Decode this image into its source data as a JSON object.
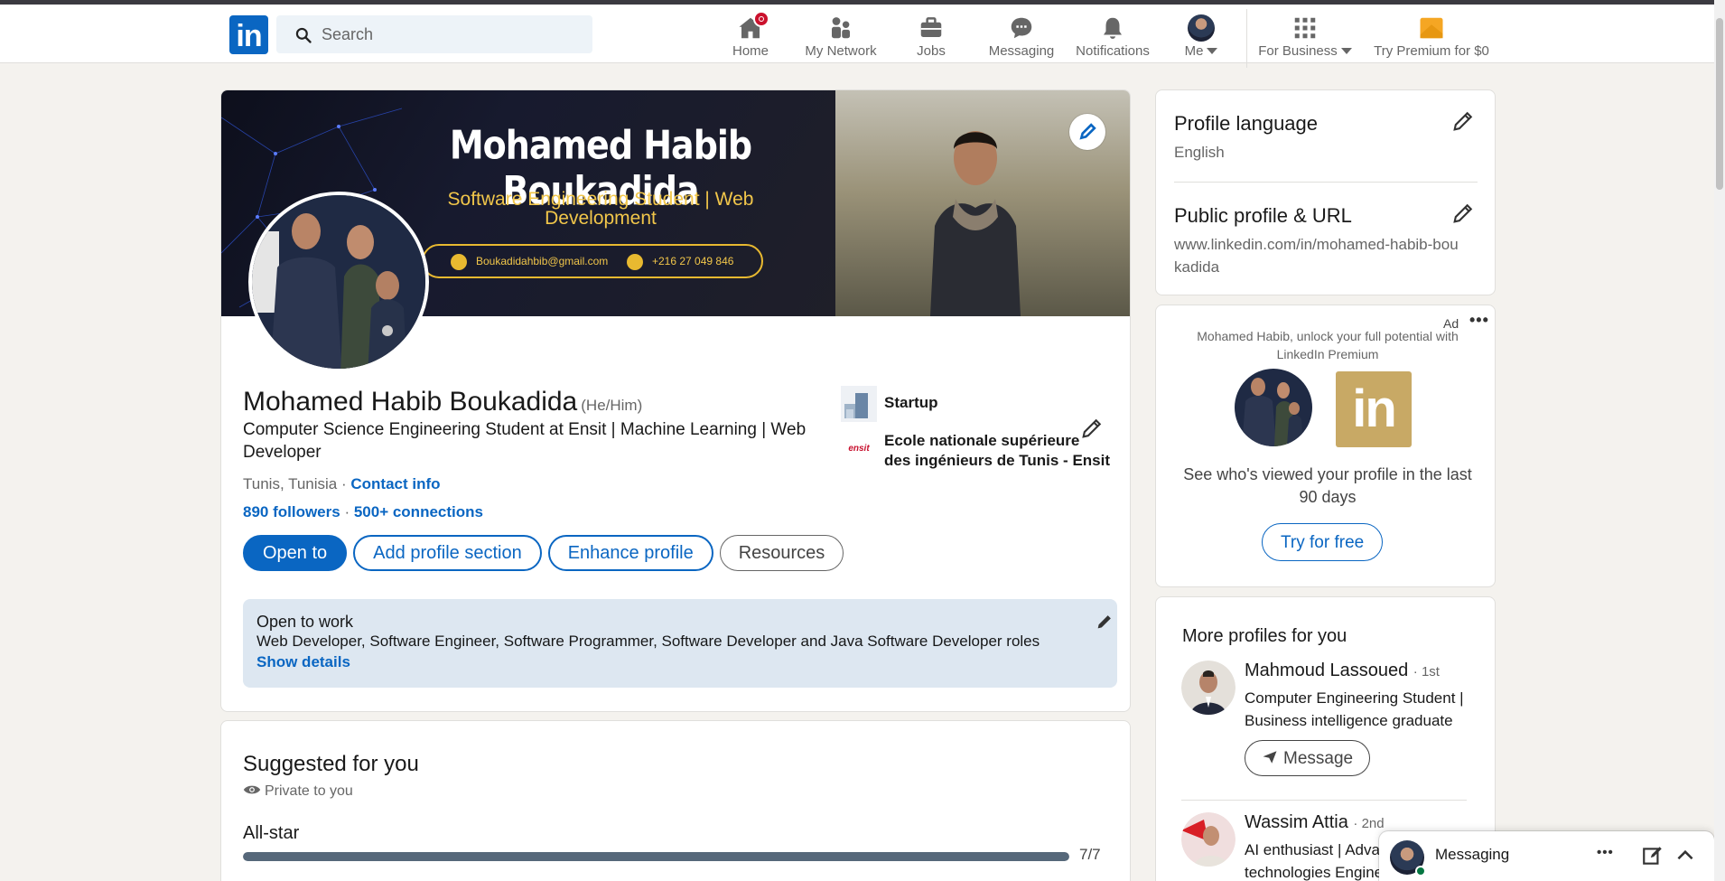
{
  "nav": {
    "search_placeholder": "Search",
    "items": [
      {
        "label": "Home",
        "icon": "home-icon"
      },
      {
        "label": "My Network",
        "icon": "network-icon"
      },
      {
        "label": "Jobs",
        "icon": "jobs-icon"
      },
      {
        "label": "Messaging",
        "icon": "messaging-icon"
      },
      {
        "label": "Notifications",
        "icon": "notifications-icon"
      },
      {
        "label": "Me",
        "icon": "avatar"
      },
      {
        "label": "For Business",
        "icon": "grid-icon"
      },
      {
        "label": "Try Premium for $0",
        "icon": "premium-icon"
      }
    ],
    "logo_text": "in"
  },
  "colors": {
    "brand": "#0a66c2",
    "badge": "#cb112d",
    "premium": "#f5a623",
    "background": "#f4f2ee"
  },
  "cover": {
    "title": "Mohamed Habib Boukadida",
    "subtitle": "Software Engineering Student | Web Development",
    "email": "Boukadidahbib@gmail.com",
    "phone": "+216 27 049 846"
  },
  "profile": {
    "name": "Mohamed Habib Boukadida",
    "pronouns": "(He/Him)",
    "headline": "Computer Science Engineering Student at Ensit | Machine Learning | Web Developer",
    "location": "Tunis, Tunisia",
    "location_sep": " · ",
    "contact_info": "Contact info",
    "followers": "890 followers",
    "connections_sep": " · ",
    "connections": "500+ connections",
    "buttons": {
      "open_to": "Open to",
      "add_section": "Add profile section",
      "enhance": "Enhance profile",
      "resources": "Resources"
    },
    "orgs": [
      {
        "name": "Startup"
      },
      {
        "name": "Ecole nationale supérieure des ingénieurs de Tunis - Ensit",
        "logo_text": "ensit"
      }
    ],
    "open_to_work": {
      "title": "Open to work",
      "roles": "Web Developer, Software Engineer, Software Programmer, Software Developer and Java Software Developer roles",
      "link": "Show details"
    }
  },
  "suggested": {
    "title": "Suggested for you",
    "private": "Private to you",
    "level": "All-star",
    "progress": 1.0,
    "count": "7/7"
  },
  "side": {
    "language": {
      "title": "Profile language",
      "value": "English"
    },
    "public_url": {
      "title": "Public profile & URL",
      "value": "www.linkedin.com/in/mohamed-habib-boukadida"
    },
    "ad": {
      "label": "Ad",
      "dots": "•••",
      "text": "Mohamed Habib, unlock your full potential with LinkedIn Premium",
      "see_views": "See who's viewed your profile in the last 90 days",
      "cta": "Try for free",
      "logo_text": "in"
    },
    "more_profiles": {
      "title": "More profiles for you",
      "items": [
        {
          "name": "Mahmoud Lassoued",
          "degree": "· 1st",
          "headline": "Computer Engineering Student | Business intelligence graduate",
          "button": "Message"
        },
        {
          "name": "Wassim Attia",
          "degree": "· 2nd",
          "headline": "AI enthusiast | Advanced technologies Engineer"
        }
      ]
    }
  },
  "messaging": {
    "label": "Messaging",
    "dots": "•••"
  }
}
